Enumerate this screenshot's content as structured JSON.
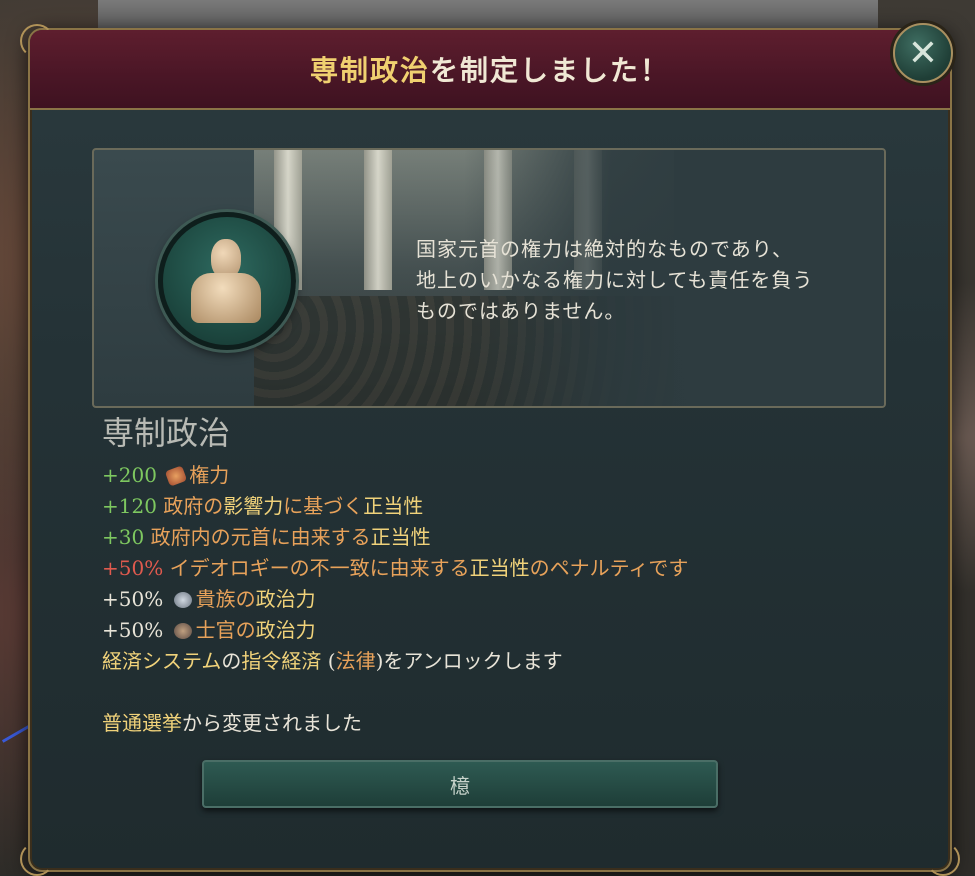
{
  "dialog": {
    "title_highlight": "専制政治",
    "title_rest": "を制定しました！",
    "close_glyph": "✕"
  },
  "illustration": {
    "quote_lines": [
      "国家元首の権力は絶対的なものであり、",
      "地上のいかなる権力に対しても責任を負う",
      "ものではありません。"
    ]
  },
  "law": {
    "name": "専制政治",
    "effects": {
      "e1": {
        "value": "+200",
        "icon": "clout-icon",
        "label": "権力"
      },
      "e2": {
        "value": "+120",
        "pre": "政府の",
        "link": "影響力",
        "mid": "に基づく",
        "link2": "正当性"
      },
      "e3": {
        "value": "+30",
        "pre": "政府内の元首に由来する",
        "link": "正当性"
      },
      "e4": {
        "value": "+50%",
        "pre": "イデオロギーの不一致に由来する",
        "link": "正当性",
        "post": "のペナルティです"
      },
      "e5": {
        "value": "+50%",
        "icon": "aristocrats-icon",
        "pre": "貴族の",
        "link": "政治力"
      },
      "e6": {
        "value": "+50%",
        "icon": "officers-icon",
        "pre": "士官の",
        "link": "政治力"
      },
      "e7": {
        "pre": "経済システム",
        "mid": "の",
        "link": "指令経済",
        "paren_open": " (",
        "link2": "法律",
        "paren_close": ")",
        "post": "をアンロックします"
      }
    },
    "changed_from": {
      "link": "普通選挙",
      "post": "から変更されました"
    }
  },
  "ok_button": {
    "label": "檍"
  },
  "colors": {
    "positive": "#7ec860",
    "negative": "#e05a4e",
    "header": "#5e1e2e",
    "frame_gold": "#8a7446"
  }
}
